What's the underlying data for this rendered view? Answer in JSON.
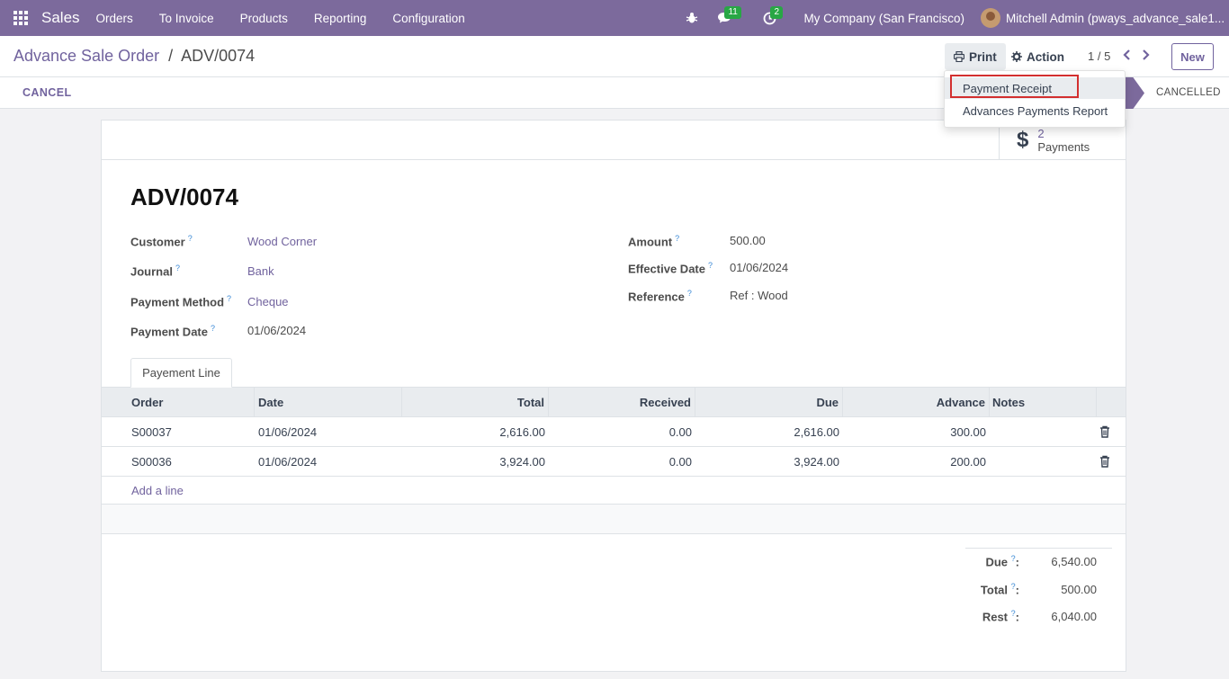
{
  "navbar": {
    "app_name": "Sales",
    "menu": [
      "Orders",
      "To Invoice",
      "Products",
      "Reporting",
      "Configuration"
    ],
    "messages_count": "11",
    "activities_count": "2",
    "company": "My Company (San Francisco)",
    "user": "Mitchell Admin (pways_advance_sale1..."
  },
  "control": {
    "breadcrumb_parent": "Advance Sale Order",
    "breadcrumb_sep": "/",
    "breadcrumb_current": "ADV/0074",
    "print_label": "Print",
    "action_label": "Action",
    "pager": "1 / 5",
    "new_label": "New"
  },
  "status": {
    "cancel_label": "CANCEL",
    "stage_cancelled": "CANCELLED"
  },
  "dropdown": {
    "items": [
      "Payment Receipt",
      "Advances Payments Report"
    ]
  },
  "stat_button": {
    "icon": "$",
    "value": "2",
    "label": "Payments"
  },
  "record": {
    "title": "ADV/0074",
    "customer_label": "Customer",
    "customer": "Wood Corner",
    "journal_label": "Journal",
    "journal": "Bank",
    "payment_method_label": "Payment Method",
    "payment_method": "Cheque",
    "payment_date_label": "Payment Date",
    "payment_date": "01/06/2024",
    "amount_label": "Amount",
    "amount": "500.00",
    "effective_date_label": "Effective Date",
    "effective_date": "01/06/2024",
    "reference_label": "Reference",
    "reference": "Ref : Wood",
    "help_mark": "?"
  },
  "tab": {
    "label": "Payement Line"
  },
  "lines": {
    "headers": [
      "Order",
      "Date",
      "Total",
      "Received",
      "Due",
      "Advance",
      "Notes"
    ],
    "rows": [
      {
        "order": "S00037",
        "date": "01/06/2024",
        "total": "2,616.00",
        "received": "0.00",
        "due": "2,616.00",
        "advance": "300.00",
        "notes": ""
      },
      {
        "order": "S00036",
        "date": "01/06/2024",
        "total": "3,924.00",
        "received": "0.00",
        "due": "3,924.00",
        "advance": "200.00",
        "notes": ""
      }
    ],
    "add_line": "Add a line"
  },
  "totals": {
    "due_label": "Due",
    "due": "6,540.00",
    "total_label": "Total",
    "total": "500.00",
    "rest_label": "Rest",
    "rest": "6,040.00",
    "colon": ":"
  },
  "colors": {
    "brand": "#7c6a9c",
    "link": "#71639e",
    "badge": "#28a745",
    "highlight": "#d32f2f"
  }
}
